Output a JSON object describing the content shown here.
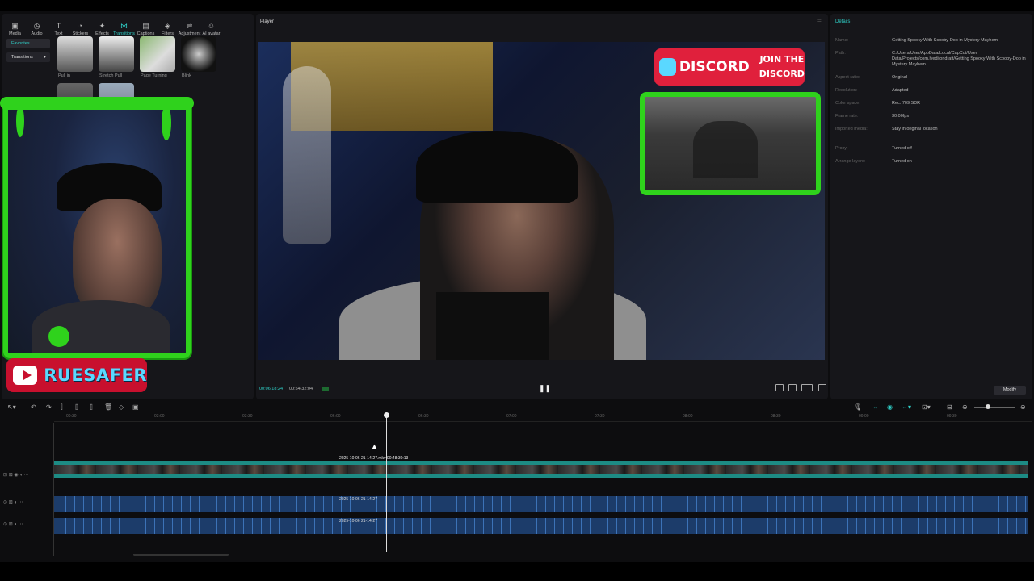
{
  "toolbar": {
    "items": [
      {
        "label": "Media",
        "icon": "media-icon"
      },
      {
        "label": "Audio",
        "icon": "audio-icon"
      },
      {
        "label": "Text",
        "icon": "text-icon"
      },
      {
        "label": "Stickers",
        "icon": "sticker-icon"
      },
      {
        "label": "Effects",
        "icon": "effects-icon"
      },
      {
        "label": "Transitions",
        "icon": "transitions-icon",
        "active": true
      },
      {
        "label": "Captions",
        "icon": "captions-icon"
      },
      {
        "label": "Filters",
        "icon": "filters-icon"
      },
      {
        "label": "Adjustment",
        "icon": "adjustment-icon"
      },
      {
        "label": "AI avatar",
        "icon": "ai-avatar-icon"
      }
    ]
  },
  "left_panel": {
    "favorites": "Favorites",
    "category": "Transitions",
    "thumbs": [
      "Pull in",
      "Stretch Pull",
      "Page Turning",
      "Blink"
    ]
  },
  "overlay": {
    "youtube_name": "RUESAFER",
    "discord_word": "DISCORD",
    "discord_join": "JOIN THE DISCORD"
  },
  "player": {
    "title": "Player",
    "current_time": "00:06:18:24",
    "total_time": "00:54:32:04"
  },
  "details": {
    "title": "Details",
    "rows": [
      {
        "label": "Name:",
        "value": "Getting Spooky With Scooby-Doo in Mystery Mayhem"
      },
      {
        "label": "Path:",
        "value": "C:/Users/User/AppData/Local/CapCut/User Data/Projects/com.lveditor.draft/Getting Spooky With Scooby-Doo in Mystery Mayhem"
      },
      {
        "label": "Aspect ratio:",
        "value": "Original"
      },
      {
        "label": "Resolution:",
        "value": "Adapted"
      },
      {
        "label": "Color space:",
        "value": "Rec. 709 SDR"
      },
      {
        "label": "Frame rate:",
        "value": "30.00fps"
      },
      {
        "label": "Imported media:",
        "value": "Stay in original location"
      },
      {
        "label": "Proxy:",
        "value": "Turned off"
      },
      {
        "label": "Arrange layers:",
        "value": "Turned on"
      }
    ],
    "modify": "Modify"
  },
  "timeline": {
    "ticks": [
      "00:30",
      "03:00",
      "03:30",
      "06:00",
      "06:30",
      "07:00",
      "07:30",
      "08:00",
      "08:30",
      "09:00",
      "09:30"
    ],
    "video_clip_label": "2025-10-06 21-14-27.mkv   00:48:30:13",
    "audio1_label": "2025-10-06 21-14-27",
    "audio2_label": "2025-10-06 21-14-27"
  }
}
